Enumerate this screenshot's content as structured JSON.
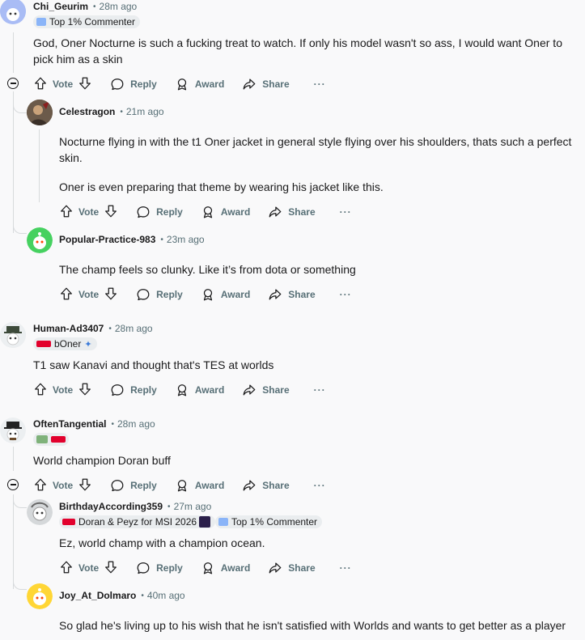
{
  "comments": [
    {
      "username": "Chi_Geurim",
      "time": "28m ago",
      "flairs": [
        "Top 1% Commenter"
      ],
      "body": "God, Oner Nocturne is such a fucking treat to watch. If only his model wasn't so ass, I would want Oner to pick him as a skin"
    },
    {
      "username": "Celestragon",
      "time": "21m ago",
      "body_p1": "Nocturne flying in with the t1 Oner jacket in general style flying over his shoulders, thats such a perfect skin.",
      "body_p2": "Oner is even preparing that theme by wearing his jacket like this."
    },
    {
      "username": "Popular-Practice-983",
      "time": "23m ago",
      "body": "The champ feels so clunky. Like it’s from dota or something"
    },
    {
      "username": "Human-Ad3407",
      "time": "28m ago",
      "flairs": [
        "bOner"
      ],
      "body": "T1 saw Kanavi and thought that's TES at worlds"
    },
    {
      "username": "OftenTangential",
      "time": "28m ago",
      "body": "World champion Doran buff"
    },
    {
      "username": "BirthdayAccording359",
      "time": "27m ago",
      "flairs": [
        "Doran & Peyz for MSI 2026",
        "Top 1% Commenter"
      ],
      "body": "Ez, world champ with a champion ocean."
    },
    {
      "username": "Joy_At_Dolmaro",
      "time": "40m ago",
      "body": "So glad he's living up to his wish that he isn't satisfied with Worlds and wants to get better as a player"
    }
  ],
  "actions": {
    "vote": "Vote",
    "reply": "Reply",
    "award": "Award",
    "share": "Share",
    "more": "···"
  },
  "colors": {
    "meta": "#576f76",
    "line": "#d7dadc",
    "flair_bg": "#eaedef",
    "t1_red": "#e2012d"
  }
}
